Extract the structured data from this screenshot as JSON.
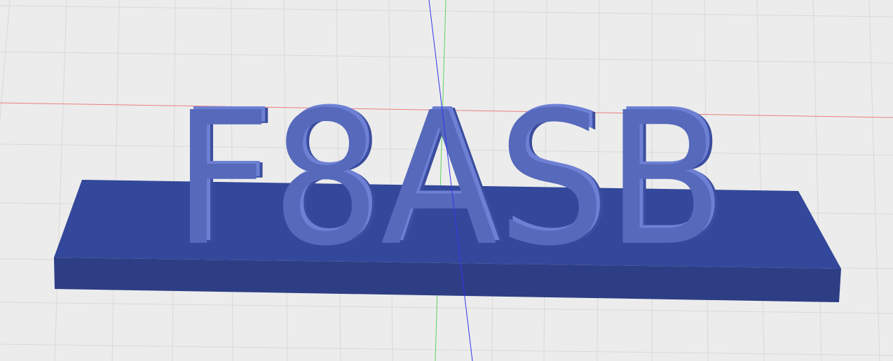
{
  "scene": {
    "model_text": "F8ASB",
    "colors": {
      "background": "#ececec",
      "grid": "#d9d9d9",
      "x_axis": "#ec7f7f",
      "y_axis": "#5fd35f",
      "z_axis": "#3434ee",
      "base_top": "#33489a",
      "base_front": "#2d3e85",
      "base_end": "#273577",
      "letter_face": "#5669bb",
      "letter_side": "#3b4d9e",
      "letter_highlight": "#6d80d4"
    }
  }
}
